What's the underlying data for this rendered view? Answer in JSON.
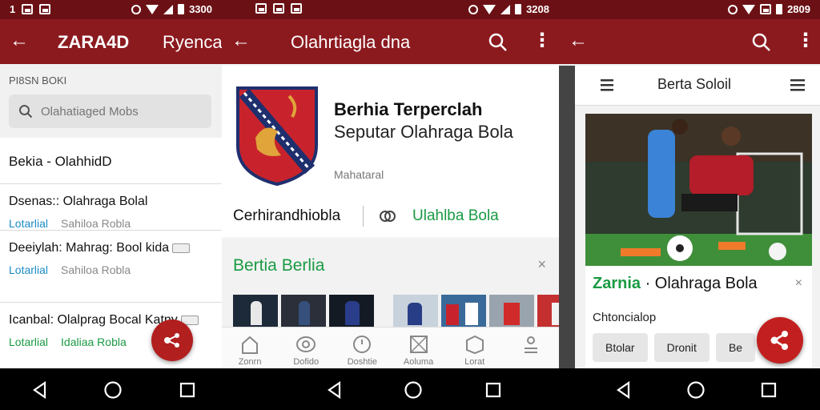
{
  "panel1": {
    "status_time": "3300",
    "title": "ZARA4D",
    "title_right": "Ryenca",
    "section_label": "PI8SN BOKI",
    "search": {
      "placeholder": "Olahatiaged Mobs"
    },
    "list_heading": "Bekia - OlahhidD",
    "items": [
      {
        "title": "Dsenas:: Olahraga Bolal",
        "category": "Lotarlial",
        "source": "Sahiloa Robla"
      },
      {
        "title": "Deeiylah: Mahrag: Bool kida",
        "category": "Lotarlial",
        "source": "Sahiloa Robla"
      },
      {
        "title": "Icanbal: Olalprag Bocal Katny",
        "category": "Lotarlial",
        "source": "Idaliaa Robla"
      }
    ]
  },
  "panel2": {
    "status_time": "3208",
    "title": "Olahrtiagla dna",
    "card_title": "Berhia Terperclah",
    "card_subtitle": "Seputar Olahraga Bola",
    "card_meta": "Mahataral",
    "row_left": "Cerhirandhiobla",
    "row_right": "Ulahlba Bola",
    "section_title": "Bertia Berlia",
    "close_icon": "×",
    "tabs": [
      {
        "label": "Zonrn",
        "icon": "home-icon"
      },
      {
        "label": "Dofido",
        "icon": "compass-icon"
      },
      {
        "label": "Doshtie",
        "icon": "grid-icon"
      },
      {
        "label": "Aoluma",
        "icon": "box-icon"
      },
      {
        "label": "Lorat",
        "icon": "person-icon"
      }
    ]
  },
  "panel3": {
    "status_time": "2809",
    "subbar_title": "Berta Soloil",
    "card_title_green": "Zarnia",
    "card_title_rest": " · Olahraga Bola",
    "card_label": "Chtoncialop",
    "chips": [
      "Btolar",
      "Dronit",
      "Be"
    ],
    "close_icon": "×"
  },
  "colors": {
    "appbar": "#8b1a1f",
    "statusbar": "#6b1116",
    "accent_green": "#1a9a43",
    "accent_blue": "#1b8bc7",
    "fab": "#c22020"
  }
}
